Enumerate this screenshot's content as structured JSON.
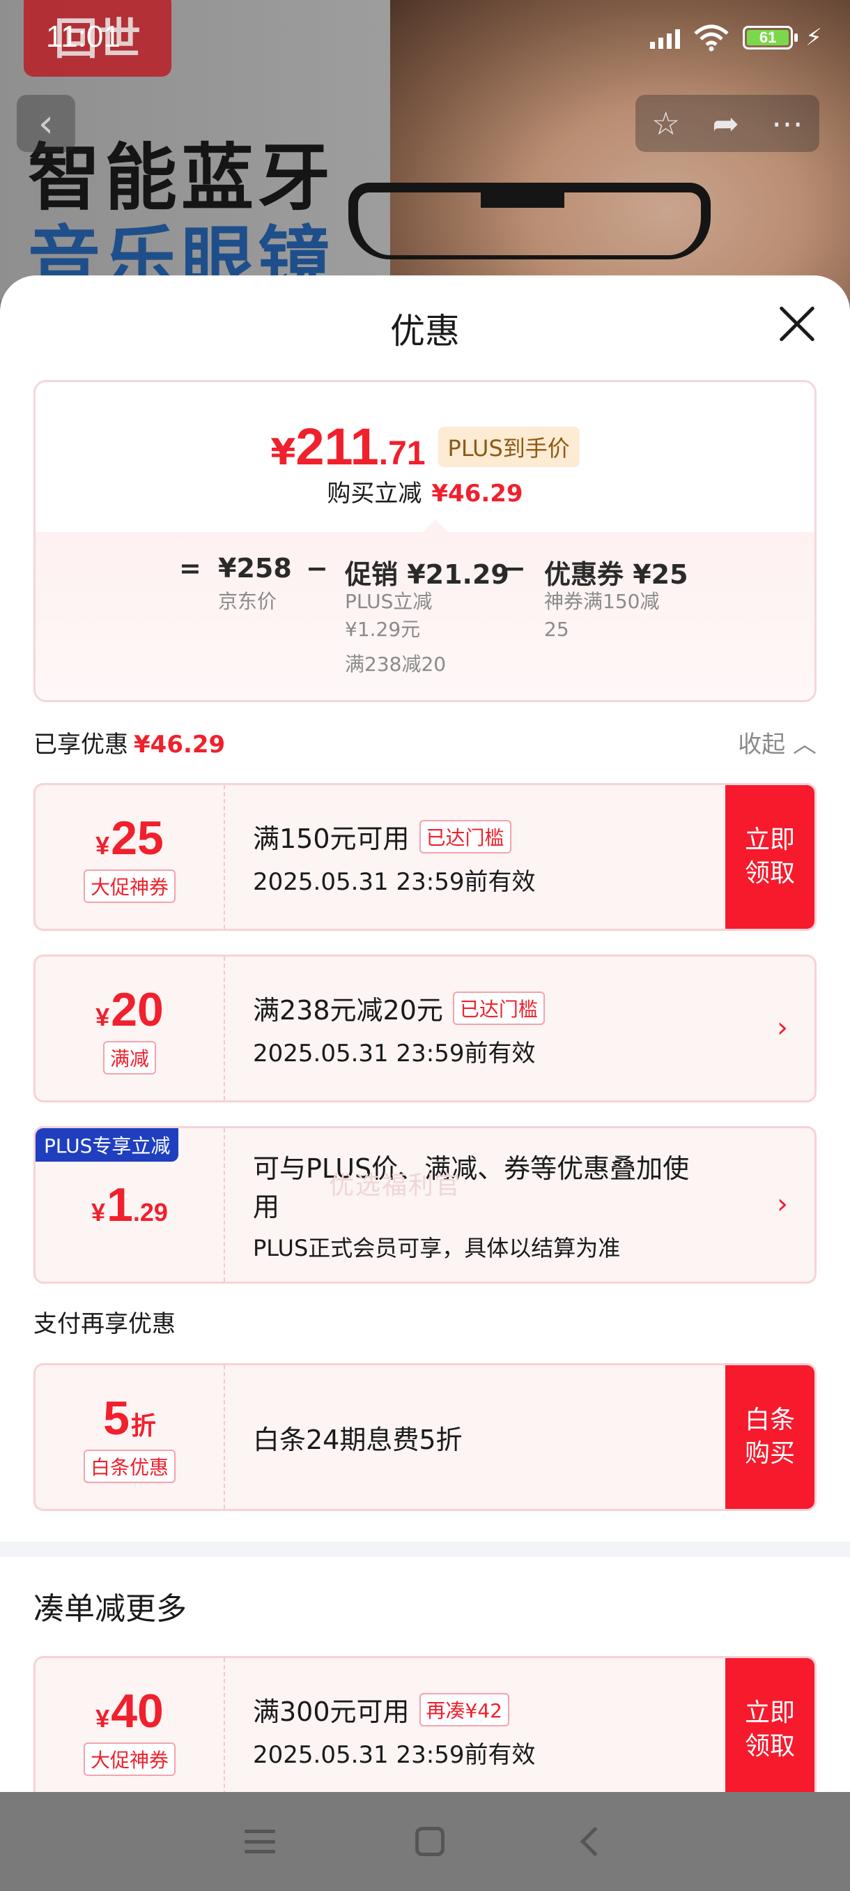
{
  "status_bar": {
    "time": "11:01",
    "battery": "61"
  },
  "banner": {
    "brand": "回世",
    "line1": "智能蓝牙",
    "line2": "音乐眼镜"
  },
  "sheet": {
    "title": "优惠",
    "summary": {
      "price_symbol": "¥",
      "price_int": "211",
      "price_dec": ".71",
      "plus_tag": "PLUS到手价",
      "reduce_label": "购买立减",
      "reduce_value": "¥46.29",
      "eq": "=",
      "jd_price": "¥258",
      "jd_label": "京东价",
      "minus1": "−",
      "promo": "促销 ¥21.29",
      "promo_sub1": "PLUS立减",
      "promo_sub2": "¥1.29元",
      "promo_sub3": "满238减20",
      "minus2": "−",
      "coupon": "优惠券 ¥25",
      "coupon_sub1": "神券满150减",
      "coupon_sub2": "25"
    },
    "enjoyed_label": "已享优惠",
    "enjoyed_value": "¥46.29",
    "collapse": "收起 ︿",
    "cards": [
      {
        "y": "¥",
        "n": "25",
        "tag": "大促神券",
        "title": "满150元可用",
        "badge": "已达门槛",
        "sub": "2025.05.31 23:59前有效",
        "cta": "立即领取"
      },
      {
        "y": "¥",
        "n": "20",
        "tag": "满减",
        "title": "满238元减20元",
        "badge": "已达门槛",
        "sub": "2025.05.31 23:59前有效",
        "chevron": "›"
      },
      {
        "ribbon": "PLUS专享立减",
        "y": "¥",
        "n": "1",
        "d": ".29",
        "title": "可与PLUS价、满减、券等优惠叠加使",
        "title2": "用",
        "sub": "PLUS正式会员可享，具体以结算为准",
        "chevron": "›"
      }
    ],
    "watermark": "优选福利官",
    "pay_section": "支付再享优惠",
    "pay_card": {
      "n": "5",
      "unit": "折",
      "tag": "白条优惠",
      "title": "白条24期息费5折",
      "cta": "白条购买"
    },
    "more_section": "凑单减更多",
    "more_card": {
      "y": "¥",
      "n": "40",
      "tag": "大促神券",
      "title": "满300元可用",
      "badge": "再凑¥42",
      "sub": "2025.05.31 23:59前有效",
      "cta": "立即领取"
    }
  },
  "colors": {
    "accent_red": "#f0202c",
    "cta_red": "#f61a2c",
    "plus_blue": "#1f3fbf"
  }
}
